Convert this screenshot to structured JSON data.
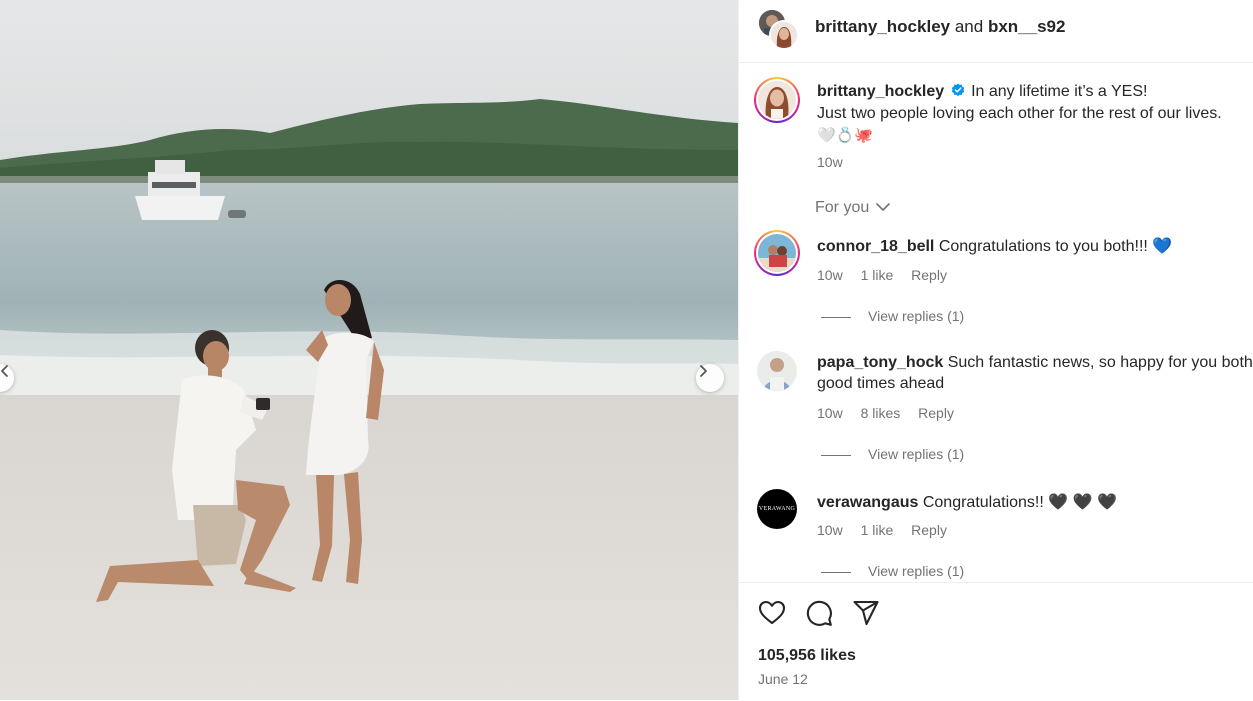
{
  "post": {
    "image_alt": "Proposal on the beach",
    "header": {
      "author1": "brittany_hockley",
      "joiner": "and",
      "author2": "bxn__s92"
    },
    "caption": {
      "username": "brittany_hockley",
      "verified": true,
      "line1": "In any lifetime it’s a YES!",
      "line2": "Just two people loving each other for the rest of our lives.",
      "emojis": "🤍💍🐙",
      "time": "10w"
    },
    "for_you": "For you",
    "comments": [
      {
        "username": "connor_18_bell",
        "text": "Congratulations to you both!!! 💙",
        "time": "10w",
        "likes": "1 like",
        "reply": "Reply",
        "view_replies": "View replies (1)"
      },
      {
        "username": "papa_tony_hock",
        "text1": "Such fantastic news, so happy for you both,",
        "text2": "good times ahead",
        "time": "10w",
        "likes": "8 likes",
        "reply": "Reply",
        "view_replies": "View replies (1)"
      },
      {
        "username": "verawangaus",
        "text": "Congratulations!! 🖤 🖤 🖤",
        "avatar_text": "VERAWANG",
        "time": "10w",
        "likes": "1 like",
        "reply": "Reply",
        "view_replies": "View replies (1)"
      }
    ],
    "likes": "105,956 likes",
    "date": "June 12"
  },
  "colors": {
    "verified": "#0095f6",
    "secondary_text": "#737373",
    "primary_text": "#262626"
  },
  "icons": [
    "chevron-right-icon",
    "chevron-left-icon",
    "heart-icon",
    "comment-icon",
    "share-icon",
    "chevron-down-icon",
    "verified-icon"
  ]
}
